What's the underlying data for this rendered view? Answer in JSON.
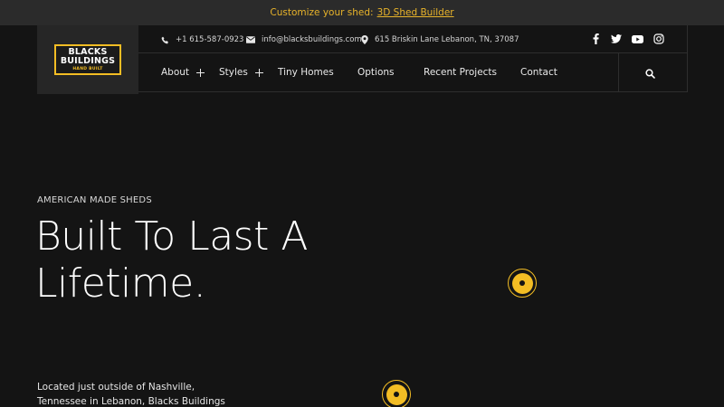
{
  "announcement": {
    "text": "Customize your shed:",
    "link_label": "3D Shed Builder"
  },
  "logo": {
    "line1": "BLACKS",
    "line2": "BUILDINGS",
    "line3": "HAND BUILT"
  },
  "contact": {
    "phone": "+1 615-587-0923",
    "email": "info@blacksbuildings.com",
    "address": "615 Briskin Lane Lebanon, TN, 37087"
  },
  "social": [
    "facebook-icon",
    "twitter-icon",
    "youtube-icon",
    "instagram-icon"
  ],
  "nav": {
    "items": [
      {
        "label": "About",
        "has_submenu": true
      },
      {
        "label": "Styles",
        "has_submenu": true
      },
      {
        "label": "Tiny Homes",
        "has_submenu": false
      },
      {
        "label": "Options",
        "has_submenu": false
      },
      {
        "label": "Recent Projects",
        "has_submenu": false
      },
      {
        "label": "Contact",
        "has_submenu": false
      }
    ]
  },
  "hero": {
    "eyebrow": "AMERICAN MADE SHEDS",
    "headline": "Built To Last A Lifetime.",
    "intro": "Located just outside of Nashville, Tennessee in Lebanon, Blacks Buildings manufactures"
  },
  "colors": {
    "accent": "#f3bd24",
    "background": "#141414",
    "topbar": "#2b2b2b"
  }
}
